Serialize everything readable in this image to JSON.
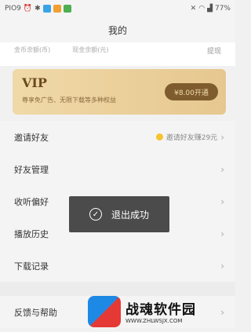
{
  "status": {
    "time": "PIO9",
    "battery": "77%"
  },
  "title": "我的",
  "wallet": {
    "coin_label": "金币余额(币)",
    "cash_label": "现金余额(元)",
    "withdraw": "提现"
  },
  "vip": {
    "title": "VIP",
    "desc": "尊享免广告、无限下载等多种权益",
    "price": "¥8.00开通",
    "bg": "#eed5a3",
    "btn_bg": "#7e5c2e"
  },
  "menu": [
    {
      "label": "邀请好友",
      "extra": "邀请好友赚29元"
    },
    {
      "label": "好友管理"
    },
    {
      "label": "收听偏好"
    },
    {
      "label": "播放历史"
    },
    {
      "label": "下载记录"
    },
    {
      "label": "反馈与帮助"
    }
  ],
  "toast": "退出成功",
  "watermark": {
    "name": "战魂软件园",
    "url": "WWW.ZHLWSJX.COM"
  }
}
